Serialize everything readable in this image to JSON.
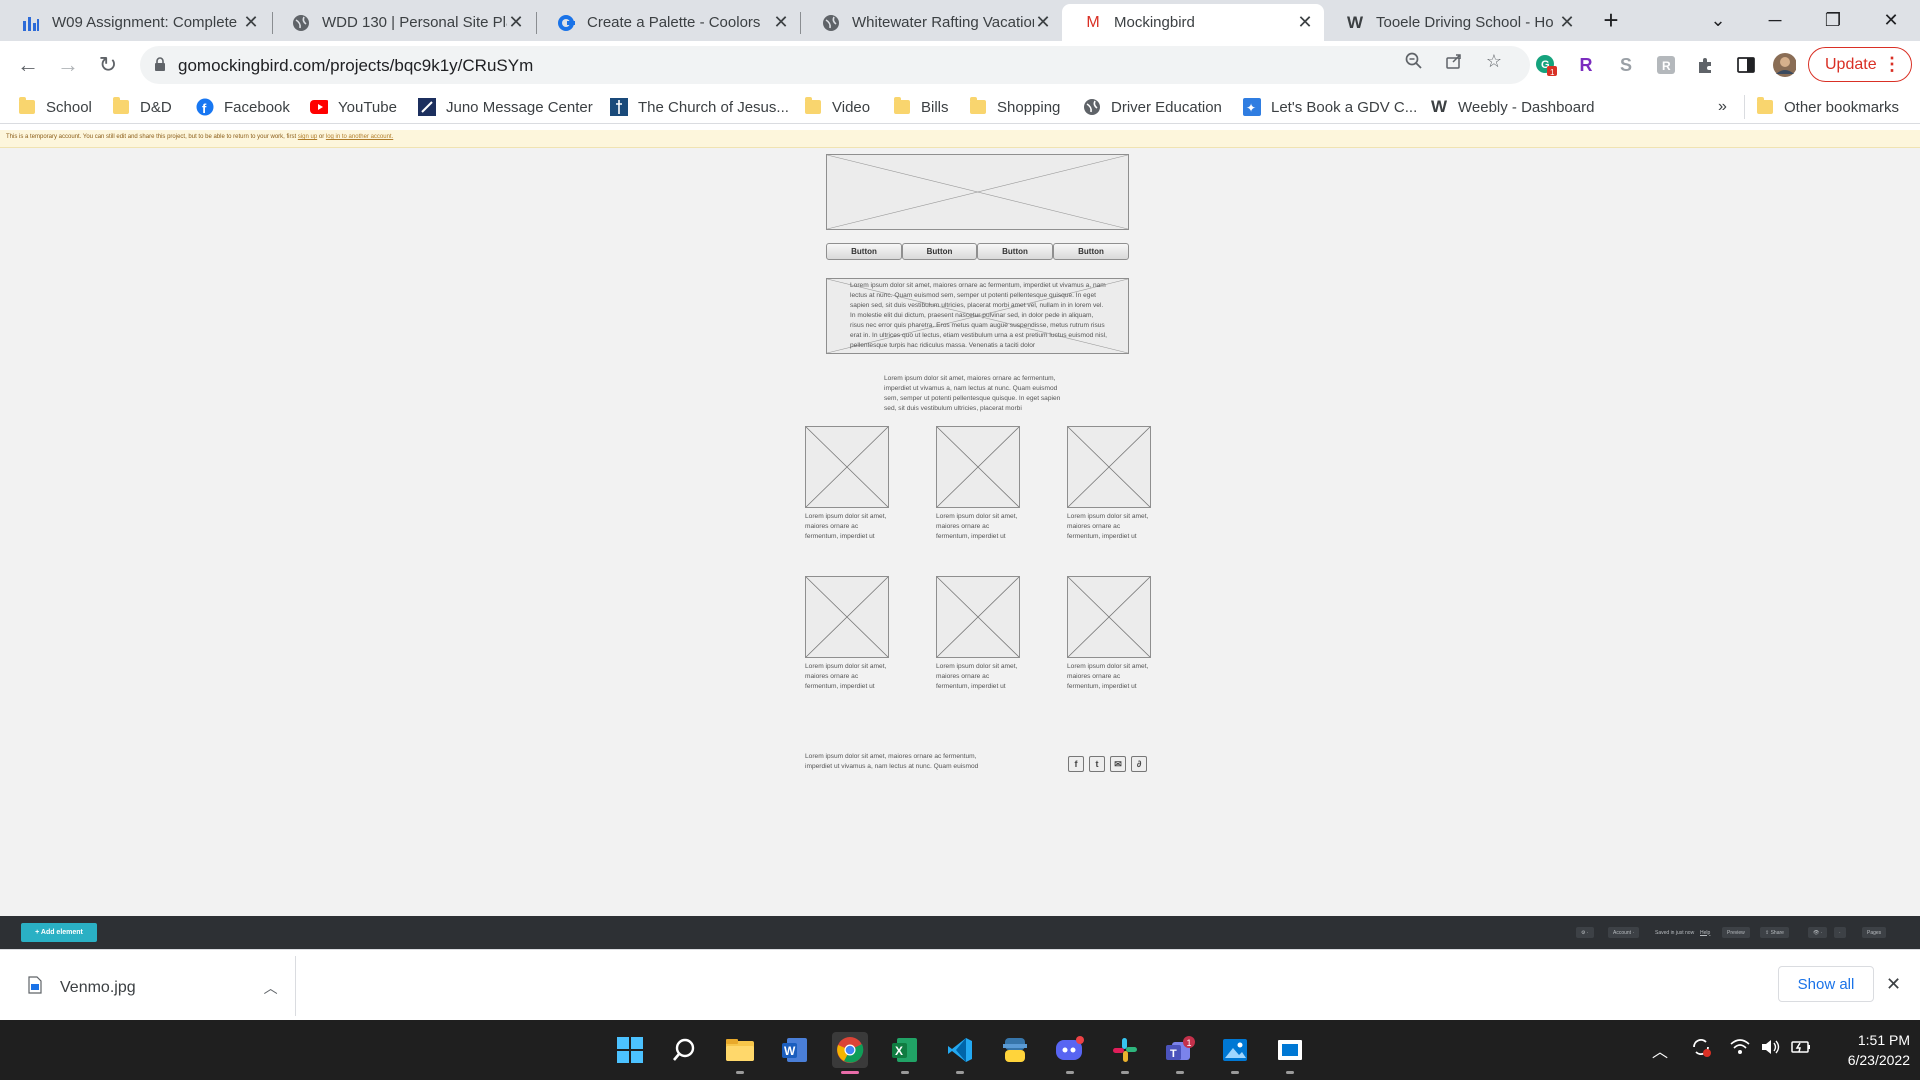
{
  "tabs": [
    {
      "title": "W09 Assignment: Complete",
      "icon": "bar-chart-icon"
    },
    {
      "title": "WDD 130 | Personal Site Pla",
      "icon": "globe-icon"
    },
    {
      "title": "Create a Palette - Coolors",
      "icon": "coolors-icon"
    },
    {
      "title": "Whitewater Rafting Vacation",
      "icon": "globe-icon"
    },
    {
      "title": "Mockingbird",
      "icon": "mockingbird-icon"
    },
    {
      "title": "Tooele Driving School - Ho",
      "icon": "weebly-icon"
    }
  ],
  "toolbar": {
    "url": "gomockingbird.com/projects/bqc9k1y/CRuSYm",
    "update_label": "Update"
  },
  "bookmarks": [
    {
      "label": "School",
      "icon": "folder-icon"
    },
    {
      "label": "D&D",
      "icon": "folder-icon"
    },
    {
      "label": "Facebook",
      "icon": "facebook-icon"
    },
    {
      "label": "YouTube",
      "icon": "youtube-icon"
    },
    {
      "label": "Juno Message Center",
      "icon": "juno-icon"
    },
    {
      "label": "The Church of Jesus...",
      "icon": "church-icon"
    },
    {
      "label": "Video",
      "icon": "folder-icon"
    },
    {
      "label": "Bills",
      "icon": "folder-icon"
    },
    {
      "label": "Shopping",
      "icon": "folder-icon"
    },
    {
      "label": "Driver Education",
      "icon": "globe-icon"
    },
    {
      "label": "Let's Book a GDV C...",
      "icon": "sparkle-icon"
    },
    {
      "label": "Weebly - Dashboard",
      "icon": "weebly-icon"
    }
  ],
  "other_bookmarks": "Other bookmarks",
  "banner": {
    "text": "This is a temporary account. You can still edit and share this project, but to be able to return to your work, first",
    "link1": "sign up",
    "mid": "or",
    "link2": "log in to another account."
  },
  "wireframe": {
    "buttons": [
      "Button",
      "Button",
      "Button",
      "Button"
    ],
    "paragraph_long": "Lorem ipsum dolor sit amet, maiores ornare ac fermentum, imperdiet ut vivamus a, nam lectus at nunc. Quam euismod sem, semper ut potenti pellentesque quisque. In eget sapien sed, sit duis vestibulum ultricies, placerat morbi amet vel, nullam in in lorem vel. In molestie elit dui dictum, praesent nascetur pulvinar sed, in dolor pede in aliquam, risus nec error quis pharetra. Eros metus quam augue suspendisse, metus rutrum risus erat in. In ultrices quo ut lectus, etiam vestibulum urna a est pretium luctus euismod nisl, pellentesque turpis hac ridiculus massa. Venenatis a taciti dolor",
    "paragraph_center": "Lorem ipsum dolor sit amet, maiores ornare ac fermentum, imperdiet ut vivamus a, nam lectus at nunc. Quam euismod sem, semper ut potenti pellentesque quisque. In eget sapien sed, sit duis vestibulum ultricies, placerat morbi",
    "caption": "Lorem ipsum dolor sit amet, maiores ornare ac fermentum, imperdiet ut",
    "footer_text": "Lorem ipsum dolor sit amet, maiores ornare ac fermentum, imperdiet ut vivamus a, nam lectus at nunc. Quam euismod sem, semper ut potenti pellentesque quisque. In eget",
    "social_icons": [
      "facebook-icon",
      "twitter-icon",
      "email-icon",
      "link-icon"
    ]
  },
  "appbar": {
    "add_element": "+ Add element",
    "items": [
      "⚙ ·",
      "Account ·",
      "Saved in just now",
      "Help",
      "Preview",
      "⇪ Share",
      "👁 ·",
      "·",
      "Pages"
    ]
  },
  "downloads": {
    "file": "Venmo.jpg",
    "show_all": "Show all"
  },
  "taskbar": {
    "time": "1:51 PM",
    "date": "6/23/2022",
    "teams_badge": "1",
    "chrome_ext_badge": "1"
  },
  "colors": {
    "tabstrip": "#dee1e6",
    "update_red": "#d93025",
    "canvas": "#f2f2f2",
    "appbar": "#2d3034",
    "accent_teal": "#2ab0c4",
    "taskbar": "#1f1f1f"
  }
}
